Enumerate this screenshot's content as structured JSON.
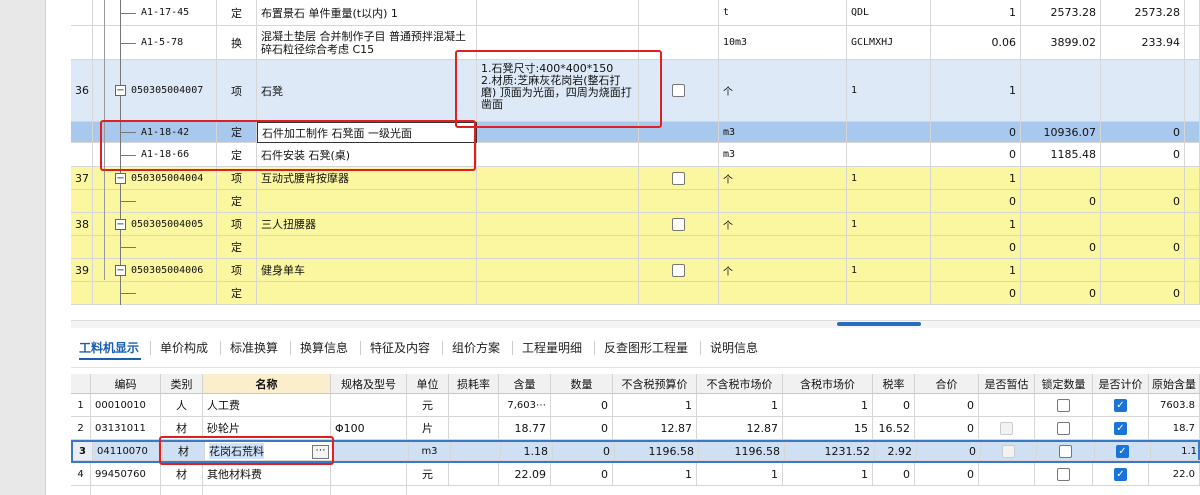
{
  "upper_rows": [
    {
      "num": "",
      "code": "A1-17-45",
      "type": "定",
      "name": "布置景石 单件重量(t以内) 1",
      "unit": "t",
      "qty_expr": "QDL",
      "qty": "1",
      "price": "2573.28",
      "total": "2573.28"
    },
    {
      "num": "",
      "code": "A1-5-78",
      "type": "换",
      "name": "混凝土垫层 合并制作子目 普通预拌混凝土 碎石粒径综合考虑 C15",
      "unit": "10m3",
      "qty_expr": "GCLMXHJ",
      "qty": "0.06",
      "price": "3899.02",
      "total": "233.94"
    },
    {
      "num": "36",
      "code": "050305004007",
      "type": "项",
      "name": "石凳",
      "feature": "1.石凳尺寸:400*400*150\n2.材质:芝麻灰花岗岩(整石打磨) 顶面为光面，四周为烧面打凿面",
      "unit": "个",
      "qty_expr": "1",
      "qty": "1",
      "price": "",
      "total": ""
    },
    {
      "num": "",
      "code": "A1-18-42",
      "type": "定",
      "name": "石件加工制作 石凳面 一级光面",
      "unit": "m3",
      "qty_expr": "",
      "qty": "0",
      "price": "10936.07",
      "total": "0"
    },
    {
      "num": "",
      "code": "A1-18-66",
      "type": "定",
      "name": "石件安装 石凳(桌)",
      "unit": "m3",
      "qty_expr": "",
      "qty": "0",
      "price": "1185.48",
      "total": "0"
    },
    {
      "num": "37",
      "code": "050305004004",
      "type": "项",
      "name": "互动式腰背按摩器",
      "unit": "个",
      "qty_expr": "1",
      "qty": "1",
      "price": "",
      "total": ""
    },
    {
      "num": "",
      "code": "",
      "type": "定",
      "name": "",
      "unit": "",
      "qty_expr": "",
      "qty": "0",
      "price": "0",
      "total": "0"
    },
    {
      "num": "38",
      "code": "050305004005",
      "type": "项",
      "name": "三人扭腰器",
      "unit": "个",
      "qty_expr": "1",
      "qty": "1",
      "price": "",
      "total": ""
    },
    {
      "num": "",
      "code": "",
      "type": "定",
      "name": "",
      "unit": "",
      "qty_expr": "",
      "qty": "0",
      "price": "0",
      "total": "0"
    },
    {
      "num": "39",
      "code": "050305004006",
      "type": "项",
      "name": "健身单车",
      "unit": "个",
      "qty_expr": "1",
      "qty": "1",
      "price": "",
      "total": ""
    },
    {
      "num": "",
      "code": "",
      "type": "定",
      "name": "",
      "unit": "",
      "qty_expr": "",
      "qty": "0",
      "price": "0",
      "total": "0"
    }
  ],
  "tabs": [
    "工料机显示",
    "单价构成",
    "标准换算",
    "换算信息",
    "特征及内容",
    "组价方案",
    "工程量明细",
    "反查图形工程量",
    "说明信息"
  ],
  "lower_headers": [
    "编码",
    "类别",
    "名称",
    "规格及型号",
    "单位",
    "损耗率",
    "含量",
    "数量",
    "不含税预算价",
    "不含税市场价",
    "含税市场价",
    "税率",
    "合价",
    "是否暂估",
    "锁定数量",
    "是否计价",
    "原始含量"
  ],
  "lower_rows": [
    {
      "idx": "1",
      "code": "00010010",
      "cat": "人",
      "name": "人工费",
      "spec": "",
      "unit": "元",
      "loss": "",
      "content": "7,603⋯",
      "qty": "0",
      "budget": "1",
      "market": "1",
      "tax_market": "1",
      "tax_rate": "0",
      "total": "0",
      "orig": "7603.8"
    },
    {
      "idx": "2",
      "code": "03131011",
      "cat": "材",
      "name": "砂轮片",
      "spec": "Φ100",
      "unit": "片",
      "loss": "",
      "content": "18.77",
      "qty": "0",
      "budget": "12.87",
      "market": "12.87",
      "tax_market": "15",
      "tax_rate": "16.52",
      "total": "0",
      "orig": "18.7"
    },
    {
      "idx": "3",
      "code": "04110070",
      "cat": "材",
      "name": "花岗石荒料",
      "spec": "",
      "unit": "m3",
      "loss": "",
      "content": "1.18",
      "qty": "0",
      "budget": "1196.58",
      "market": "1196.58",
      "tax_market": "1231.52",
      "tax_rate": "2.92",
      "total": "0",
      "orig": "1.1"
    },
    {
      "idx": "4",
      "code": "99450760",
      "cat": "材",
      "name": "其他材料费",
      "spec": "",
      "unit": "元",
      "loss": "",
      "content": "22.09",
      "qty": "0",
      "budget": "1",
      "market": "1",
      "tax_market": "1",
      "tax_rate": "0",
      "total": "0",
      "orig": "22.0"
    }
  ],
  "more_button": "⋯",
  "colors": {
    "yellow_row": "#fbf7a0",
    "blue_row": "#dde9f7",
    "selected_row": "#a9c8ee",
    "highlight": "#e02020",
    "tab_active": "#1a5fb4"
  }
}
